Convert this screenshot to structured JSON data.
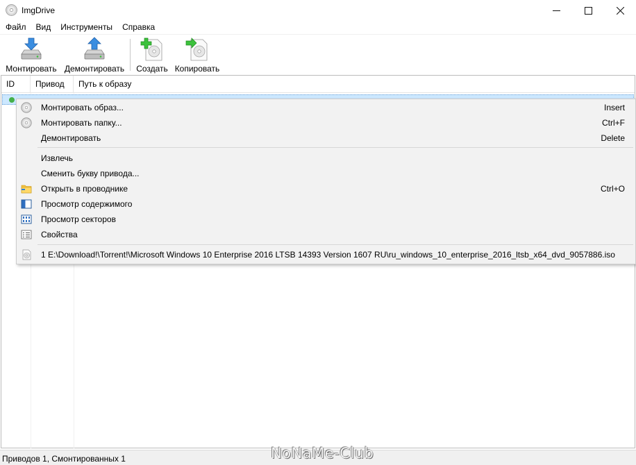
{
  "window": {
    "title": "ImgDrive",
    "minimize": "—",
    "maximize": "☐",
    "close": "✕"
  },
  "menu": [
    "Файл",
    "Вид",
    "Инструменты",
    "Справка"
  ],
  "toolbar": {
    "mount": "Монтировать",
    "unmount": "Демонтировать",
    "create": "Создать",
    "copy": "Копировать"
  },
  "list": {
    "columns": [
      "ID",
      "Привод",
      "Путь к образу"
    ],
    "rows": [
      {
        "status": "mounted",
        "status_color": "#45b04a"
      }
    ]
  },
  "context_menu": {
    "items": [
      {
        "label": "Монтировать образ...",
        "shortcut": "Insert",
        "icon": "disc-icon"
      },
      {
        "label": "Монтировать папку...",
        "shortcut": "Ctrl+F",
        "icon": "disc-icon"
      },
      {
        "label": "Демонтировать",
        "shortcut": "Delete",
        "icon": ""
      },
      {
        "label": "Извлечь",
        "shortcut": "",
        "icon": ""
      },
      {
        "label": "Сменить букву привода...",
        "shortcut": "",
        "icon": ""
      },
      {
        "label": "Открыть в проводнике",
        "shortcut": "Ctrl+O",
        "icon": "folder-icon"
      },
      {
        "label": "Просмотр содержимого",
        "shortcut": "",
        "icon": "window-icon"
      },
      {
        "label": "Просмотр секторов",
        "shortcut": "",
        "icon": "sectors-icon"
      },
      {
        "label": "Свойства",
        "shortcut": "",
        "icon": "properties-icon"
      }
    ],
    "recent": "1 E:\\Download!\\Torrent!\\Microsoft Windows 10 Enterprise 2016 LTSB 14393 Version 1607 RU\\ru_windows_10_enterprise_2016_ltsb_x64_dvd_9057886.iso"
  },
  "status": "Приводов 1, Смонтированных 1",
  "watermark": "NoNaMe-Club",
  "colors": {
    "selection": "#cce8ff",
    "menu_bg": "#f2f2f2",
    "mounted_dot": "#45b04a"
  }
}
